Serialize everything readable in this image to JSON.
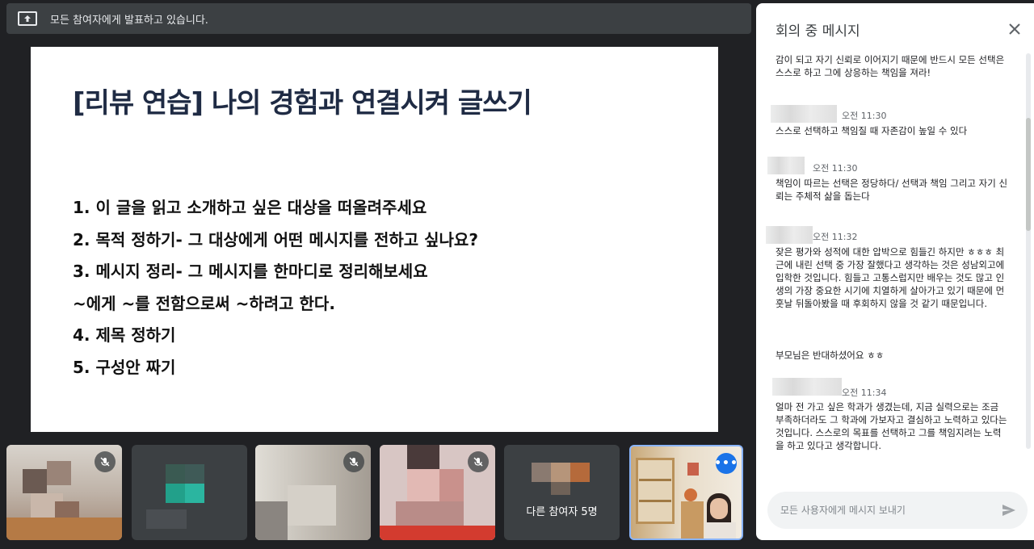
{
  "presenting_bar": {
    "text": "모든 참여자에게 발표하고 있습니다.",
    "icon": "present-to-all-icon"
  },
  "slide": {
    "title": "[리뷰 연습] 나의 경험과 연결시켜 글쓰기",
    "lines": [
      "1. 이 글을 읽고 소개하고 싶은 대상을 떠올려주세요",
      "2. 목적 정하기- 그 대상에게 어떤 메시지를 전하고 싶나요?",
      "3. 메시지 정리- 그 메시지를 한마디로 정리해보세요",
      "~에게 ~를 전함으로써 ~하려고 한다.",
      "4. 제목 정하기",
      "5. 구성안 짜기"
    ]
  },
  "tiles": {
    "others_label": "다른 참여자 5명",
    "mute_icon": "mic-off-icon",
    "more_icon": "more-options-icon"
  },
  "chat": {
    "title": "회의 중 메시지",
    "close_icon": "close-icon",
    "messages": [
      {
        "text": "감이 되고 자기 신뢰로 이어지기 때문에 반드시 모든 선택은 스스로 하고 그에 상응하는 책임을 져라!"
      },
      {
        "time": "오전 11:30",
        "text": "스스로 선택하고 책임질 때 자존감이 높일 수 있다"
      },
      {
        "time": "오전 11:30",
        "text": "책임이 따르는 선택은 정당하다/ 선택과 책임 그리고 자기 신뢰는 주체적 삶을 돕는다"
      },
      {
        "time": "오전 11:32",
        "text": "잦은 평가와 성적에 대한 압박으로 힘들긴 하지만 ㅎㅎㅎ 최근에 내린 선택 중 가장 잘했다고 생각하는 것은 성남외고에 입학한 것입니다. 힘들고 고통스럽지만 배우는 것도 많고 인생의 가장 중요한 시기에 치열하게 살아가고 있기 때문에 먼훗날 뒤돌아봤을 때 후회하지 않을 것 같기 때문입니다."
      },
      {
        "text": "부모님은 반대하셨어요 ㅎㅎ"
      },
      {
        "time": "오전 11:34",
        "text": "얼마 전 가고 싶은 학과가 생겼는데, 지금 실력으로는 조금 부족하더라도 그 학과에 가보자고 결심하고 노력하고 있다는 것입니다. 스스로의 목표를 선택하고 그를 책임지려는 노력을 하고 있다고 생각합니다."
      }
    ],
    "input_placeholder": "모든 사용자에게 메시지 보내기",
    "send_icon": "send-icon"
  }
}
